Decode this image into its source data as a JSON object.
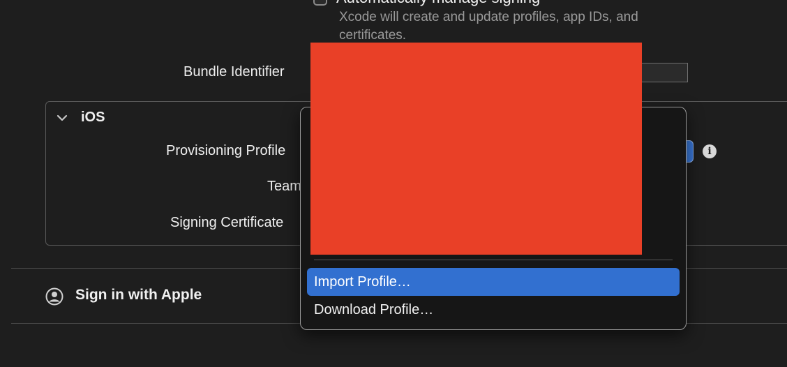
{
  "signing": {
    "auto_manage_label": "Automatically manage signing",
    "auto_manage_desc": "Xcode will create and update profiles, app IDs, and certificates.",
    "bundle_identifier_label": "Bundle Identifier"
  },
  "ios_section": {
    "title": "iOS",
    "provisioning_profile_label": "Provisioning Profile",
    "team_label": "Team",
    "signing_certificate_label": "Signing Certificate",
    "info_icon_glyph": "i"
  },
  "capabilities": {
    "sign_in_with_apple_label": "Sign in with Apple"
  },
  "menu": {
    "items": [
      {
        "label": "Import Profile…",
        "highlighted": true
      },
      {
        "label": "Download Profile…",
        "highlighted": false
      }
    ]
  },
  "colors": {
    "background": "#1e1e1e",
    "highlight": "#3270d0",
    "redaction": "#e94027"
  }
}
